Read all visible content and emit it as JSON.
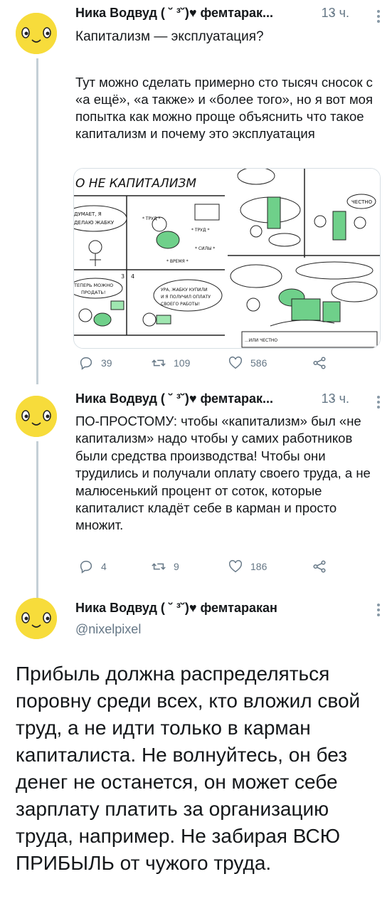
{
  "author": {
    "name_truncated": "Ника Водвуд ( ˘ ³˘)♥ фемтарак...",
    "name_full": "Ника Водвуд ( ˘ ³˘)♥ фемтаракан",
    "handle": "@nixelpixel"
  },
  "tweets": [
    {
      "time": "13 ч.",
      "text": "Капитализм — эксплуатация?",
      "text2": "Тут можно сделать примерно сто тысяч сносок с «а ещё», «а также» и «более того», но я вот моя попытка как можно проще объяснить что такое капитализм и почему это эксплуатация",
      "comic": {
        "title": "О НЕ КАПИТАЛИЗМ",
        "panel1": "ДУМАЕТ, Я ДЕЛАЮ ЖАБКУ",
        "panel2_labels": [
          "* ТРУД *",
          "* ТРУД *",
          "* СИЛЫ *",
          "* ВРЕМЯ *"
        ],
        "panel3": "ТЕПЕРЬ МОЖНО ПРОДАТЬ!",
        "panel4": "УРА, ЖАБКУ КУПИЛИ И Я ПОЛУЧИЛ ОПЛАТУ СВОЕГО РАБОТЫ!",
        "num3": "3",
        "num4": "4",
        "right_top_bubble": "ЧЕСТНО",
        "right_bottom_note": "...ИЛИ ЧЕСТНО"
      },
      "counts": {
        "replies": "39",
        "retweets": "109",
        "likes": "586"
      }
    },
    {
      "time": "13 ч.",
      "text": "ПО-ПРОСТОМУ: чтобы «капитализм» был «не капитализм» надо чтобы у самих работников были средства производства! Чтобы они трудились и получали оплату своего труда, а не малюсенький процент от соток, которые капиталист кладёт себе в карман и просто множит.",
      "counts": {
        "replies": "4",
        "retweets": "9",
        "likes": "186"
      }
    },
    {
      "text": "Прибыль должна распределяться поровну среди всех, кто вложил свой труд, а не идти только в карман капиталиста. Не волнуйтесь, он без денег не останется, он может себе зарплату платить за организацию труда, например. Не забирая ВСЮ ПРИБЫЛЬ от чужого труда."
    }
  ],
  "colors": {
    "avatar": "#f7dc3b",
    "muted": "#657786",
    "line": "#c4cfd6",
    "frog": "#6fd08a"
  }
}
